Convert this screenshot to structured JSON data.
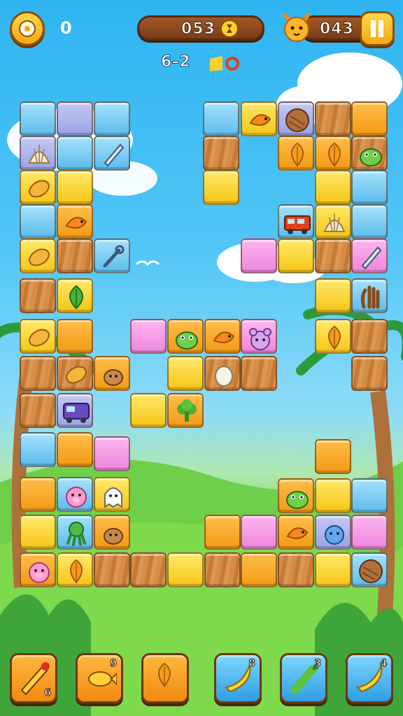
{
  "hud": {
    "score": "0",
    "moves": "053",
    "coins": "043",
    "level": "6–2"
  },
  "boosters": [
    {
      "icon": "pencil-icon",
      "count": "6"
    },
    {
      "icon": "fish-icon",
      "count": "9"
    },
    {
      "icon": "leaf-icon",
      "count": ""
    },
    {
      "icon": "banana-icon",
      "count": "8"
    },
    {
      "icon": "vegetable-icon",
      "count": "3"
    },
    {
      "icon": "banana-icon",
      "count": "4"
    }
  ],
  "colors": {
    "sky": "#2fb4f1",
    "grass": "#5fbf34",
    "hud_brown": "#7a3d18",
    "button_yellow": "#f5a712"
  }
}
